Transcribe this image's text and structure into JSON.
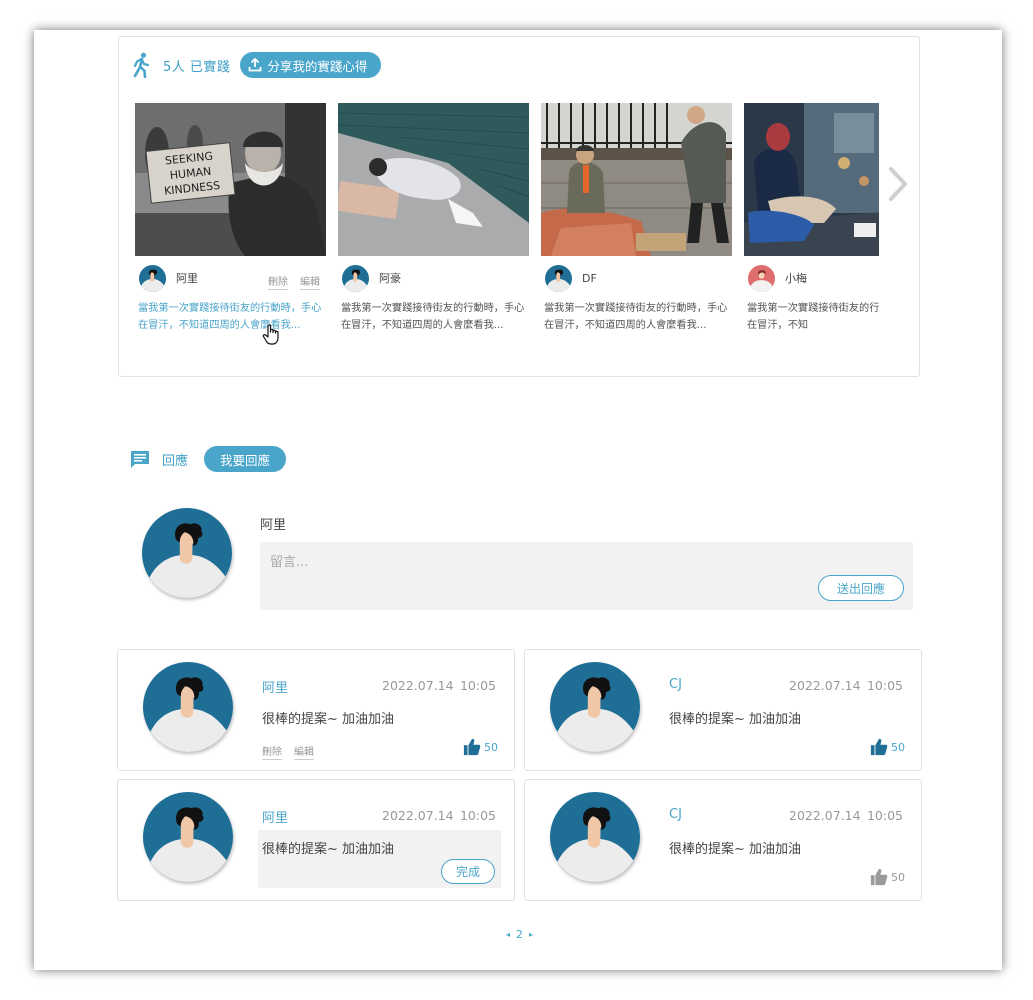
{
  "colors": {
    "accent": "#4aa5ca",
    "text": "#444444",
    "muted": "#999999",
    "input_bg": "#f2f2f2"
  },
  "practice": {
    "count_label": "5人 已實踐",
    "share_button": "分享我的實踐心得",
    "icon": "walking-person-icon",
    "items": [
      {
        "author": "阿里",
        "excerpt": "當我第一次實踐接待街友的行動時，手心在冒汗，不知道四周的人會麼看我...",
        "delete": "刪除",
        "edit": "編輯",
        "photo_sign": [
          "SEEKING",
          "HUMAN",
          "KINDNESS"
        ]
      },
      {
        "author": "阿豪",
        "excerpt": "當我第一次實踐接待街友的行動時，手心在冒汗，不知道四周的人會麼看我..."
      },
      {
        "author": "DF",
        "excerpt": "當我第一次實踐接待街友的行動時，手心在冒汗，不知道四周的人會麼看我..."
      },
      {
        "author": "小梅",
        "excerpt": "當我第一次實踐接待街友的行動時，手心在冒汗，不知"
      }
    ]
  },
  "responses": {
    "label": "回應",
    "reply_button": "我要回應",
    "compose": {
      "name": "阿里",
      "placeholder": "留言...",
      "send_button": "送出回應"
    },
    "comments": [
      {
        "name": "阿里",
        "date": "2022.07.14",
        "time": "10:05",
        "text": "很棒的提案~ 加油加油",
        "likes": "50",
        "delete": "刪除",
        "edit": "編輯"
      },
      {
        "name": "CJ",
        "date": "2022.07.14",
        "time": "10:05",
        "text": "很棒的提案~ 加油加油",
        "likes": "50"
      },
      {
        "name": "阿里",
        "date": "2022.07.14",
        "time": "10:05",
        "text": "很棒的提案~ 加油加油",
        "done_button": "完成"
      },
      {
        "name": "CJ",
        "date": "2022.07.14",
        "time": "10:05",
        "text": "很棒的提案~ 加油加油",
        "likes": "50"
      }
    ]
  },
  "pager": {
    "prev": "◂",
    "page": "2",
    "next": "▸"
  }
}
